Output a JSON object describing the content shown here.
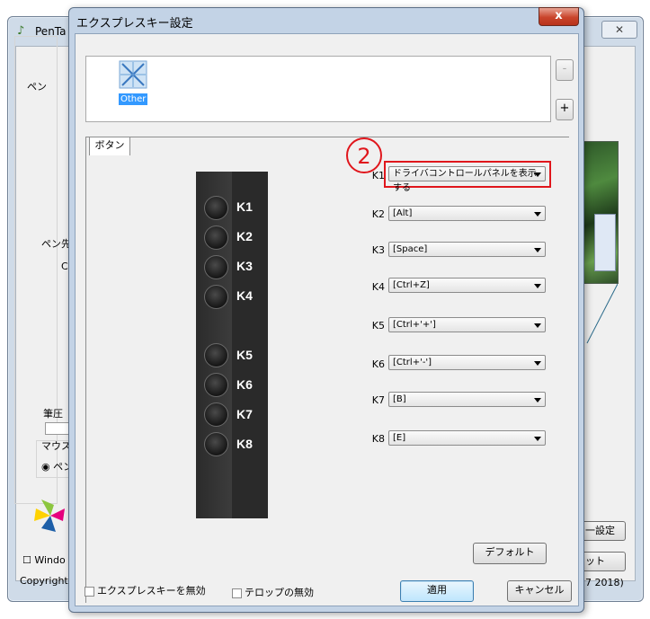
{
  "background_window": {
    "title": "PenTa",
    "close_glyph": "✕",
    "pen_group_label": "ペン",
    "pentip_label": "ペン先",
    "pentip_value": "C",
    "pressure_label": "筆圧",
    "mouse_label": "マウス",
    "radio_pen_label": "ペン",
    "windows_check_label": "Windo",
    "copyright_left": "Copyright",
    "copyright_right": "7 2018)",
    "settings_button_label": "一設定",
    "ok_button_label": "ット"
  },
  "dialog": {
    "title": "エクスプレスキー設定",
    "close_glyph": "x",
    "app_list": {
      "items": [
        {
          "label": "Other",
          "icon": "generic-app-icon",
          "selected": true
        }
      ],
      "remove_label": "-",
      "add_label": "+"
    },
    "tab_label": "ボタン",
    "annotation_number": "2",
    "device_keys": [
      "K1",
      "K2",
      "K3",
      "K4",
      "K5",
      "K6",
      "K7",
      "K8"
    ],
    "key_assignments": [
      {
        "key": "K1",
        "value": "ドライバコントロールパネルを表示する",
        "highlighted": true
      },
      {
        "key": "K2",
        "value": "[Alt]"
      },
      {
        "key": "K3",
        "value": "[Space]"
      },
      {
        "key": "K4",
        "value": "[Ctrl+Z]"
      },
      {
        "key": "K5",
        "value": "[Ctrl+'+']"
      },
      {
        "key": "K6",
        "value": "[Ctrl+'-']"
      },
      {
        "key": "K7",
        "value": "[B]"
      },
      {
        "key": "K8",
        "value": "[E]"
      }
    ],
    "default_button_label": "デフォルト",
    "disable_expresskeys_label": "エクスプレスキーを無効",
    "disable_telop_label": "テロップの無効",
    "apply_button_label": "適用",
    "cancel_button_label": "キャンセル"
  },
  "colors": {
    "highlight_border": "#e0161c",
    "selection_blue": "#3399ff",
    "dialog_frame": "#c3d3e6"
  }
}
